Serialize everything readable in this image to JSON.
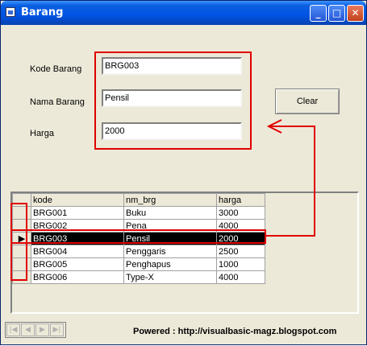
{
  "window": {
    "title": "Barang"
  },
  "form": {
    "kode_label": "Kode Barang",
    "kode_value": "BRG003",
    "nama_label": "Nama Barang",
    "nama_value": "Pensil",
    "harga_label": "Harga",
    "harga_value": "2000",
    "clear_label": "Clear"
  },
  "grid": {
    "columns": [
      "kode",
      "nm_brg",
      "harga"
    ],
    "rows": [
      [
        "BRG001",
        "Buku",
        "3000"
      ],
      [
        "BRG002",
        "Pena",
        "4000"
      ],
      [
        "BRG003",
        "Pensil",
        "2000"
      ],
      [
        "BRG004",
        "Penggaris",
        "2500"
      ],
      [
        "BRG005",
        "Penghapus",
        "1000"
      ],
      [
        "BRG006",
        "Type-X",
        "4000"
      ]
    ],
    "selected_row": 2
  },
  "footer": {
    "powered": "Powered : http://visualbasic-magz.blogspot.com"
  },
  "colors": {
    "title_bar": "#0054e3",
    "highlight": "#e00000",
    "selected_row": "#000000"
  }
}
